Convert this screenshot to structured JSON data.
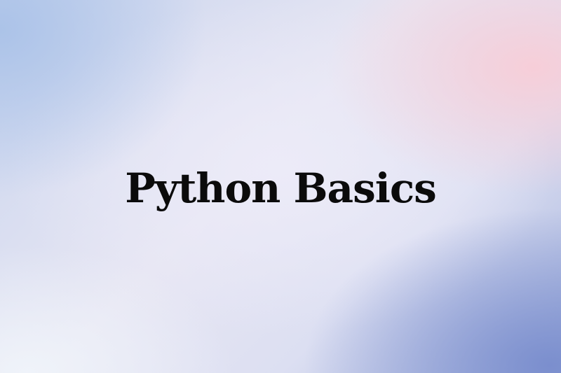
{
  "title": "Python Basics",
  "colors": {
    "text": "#0b0b0b",
    "background_top_left": "#c8d4ee",
    "background_center": "#ecebf8",
    "background_top_right_glow": "#f8cdd7",
    "background_bottom_right": "#788ccd"
  }
}
